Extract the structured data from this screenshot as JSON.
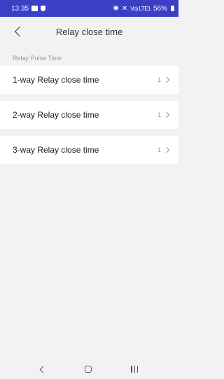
{
  "status_bar": {
    "time": "13:35",
    "signal_text": "Vo) LTE1",
    "battery": "56%"
  },
  "header": {
    "title": "Relay close time"
  },
  "section": {
    "label": "Relay Pulse Time"
  },
  "items": [
    {
      "label": "1-way Relay close time",
      "value": "1"
    },
    {
      "label": "2-way Relay close time",
      "value": "1"
    },
    {
      "label": "3-way Relay close time",
      "value": "1"
    }
  ],
  "icons": {
    "back": "chevron-left-icon",
    "row": "chevron-right-icon",
    "nav_back": "nav-back-icon",
    "nav_home": "nav-home-icon",
    "nav_recent": "nav-recent-icon"
  },
  "colors": {
    "status_bar": "#3b3fc4",
    "background": "#f2f2f4",
    "card": "#ffffff"
  }
}
